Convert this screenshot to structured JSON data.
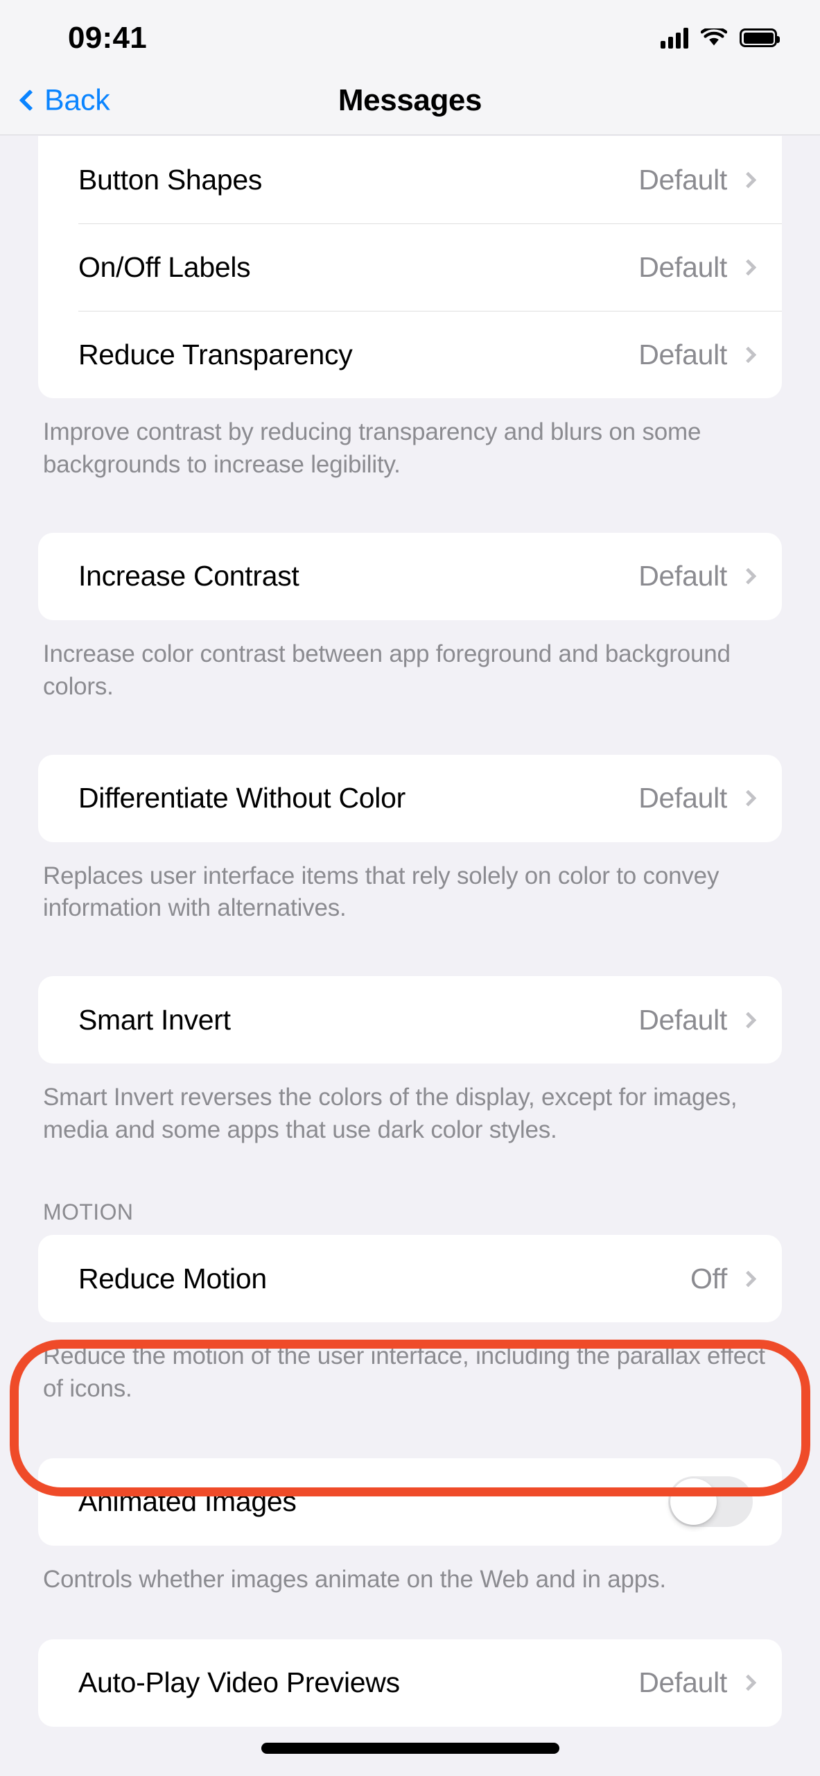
{
  "status_bar": {
    "time": "09:41",
    "cellular_icon": "cellular-bars-icon",
    "wifi_icon": "wifi-icon",
    "battery_icon": "battery-full-icon"
  },
  "nav": {
    "back_label": "Back",
    "back_icon": "chevron-left-icon",
    "title": "Messages"
  },
  "colors": {
    "accent_blue": "#0a84ff",
    "highlight_red": "#ef4b29",
    "page_background": "#f2f1f6",
    "card_background": "#ffffff",
    "secondary_text": "#8b8b90",
    "toggle_off_track": "#e9e9eb"
  },
  "sections": [
    {
      "name": "display-group",
      "rows": [
        {
          "label": "Button Shapes",
          "value": "Default",
          "accessory": "disclosure"
        },
        {
          "label": "On/Off Labels",
          "value": "Default",
          "accessory": "disclosure"
        },
        {
          "label": "Reduce Transparency",
          "value": "Default",
          "accessory": "disclosure"
        }
      ],
      "footer": "Improve contrast by reducing transparency and blurs on some backgrounds to increase legibility."
    },
    {
      "name": "increase-contrast-group",
      "rows": [
        {
          "label": "Increase Contrast",
          "value": "Default",
          "accessory": "disclosure"
        }
      ],
      "footer": "Increase color contrast between app foreground and background colors."
    },
    {
      "name": "differentiate-without-color-group",
      "rows": [
        {
          "label": "Differentiate Without Color",
          "value": "Default",
          "accessory": "disclosure"
        }
      ],
      "footer": "Replaces user interface items that rely solely on color to convey information with alternatives."
    },
    {
      "name": "smart-invert-group",
      "rows": [
        {
          "label": "Smart Invert",
          "value": "Default",
          "accessory": "disclosure"
        }
      ],
      "footer": "Smart Invert reverses the colors of the display, except for images, media and some apps that use dark color styles."
    },
    {
      "name": "motion-group",
      "header": "MOTION",
      "rows": [
        {
          "label": "Reduce Motion",
          "value": "Off",
          "accessory": "disclosure"
        }
      ],
      "footer": "Reduce the motion of the user interface, including the parallax effect of icons."
    },
    {
      "name": "animated-images-group",
      "highlighted": true,
      "rows": [
        {
          "label": "Animated Images",
          "value": "",
          "accessory": "toggle",
          "toggle_state": "off"
        }
      ],
      "footer": "Controls whether images animate on the Web and in apps."
    },
    {
      "name": "auto-play-group",
      "rows": [
        {
          "label": "Auto-Play Video Previews",
          "value": "Default",
          "accessory": "disclosure"
        }
      ],
      "footer": ""
    }
  ]
}
